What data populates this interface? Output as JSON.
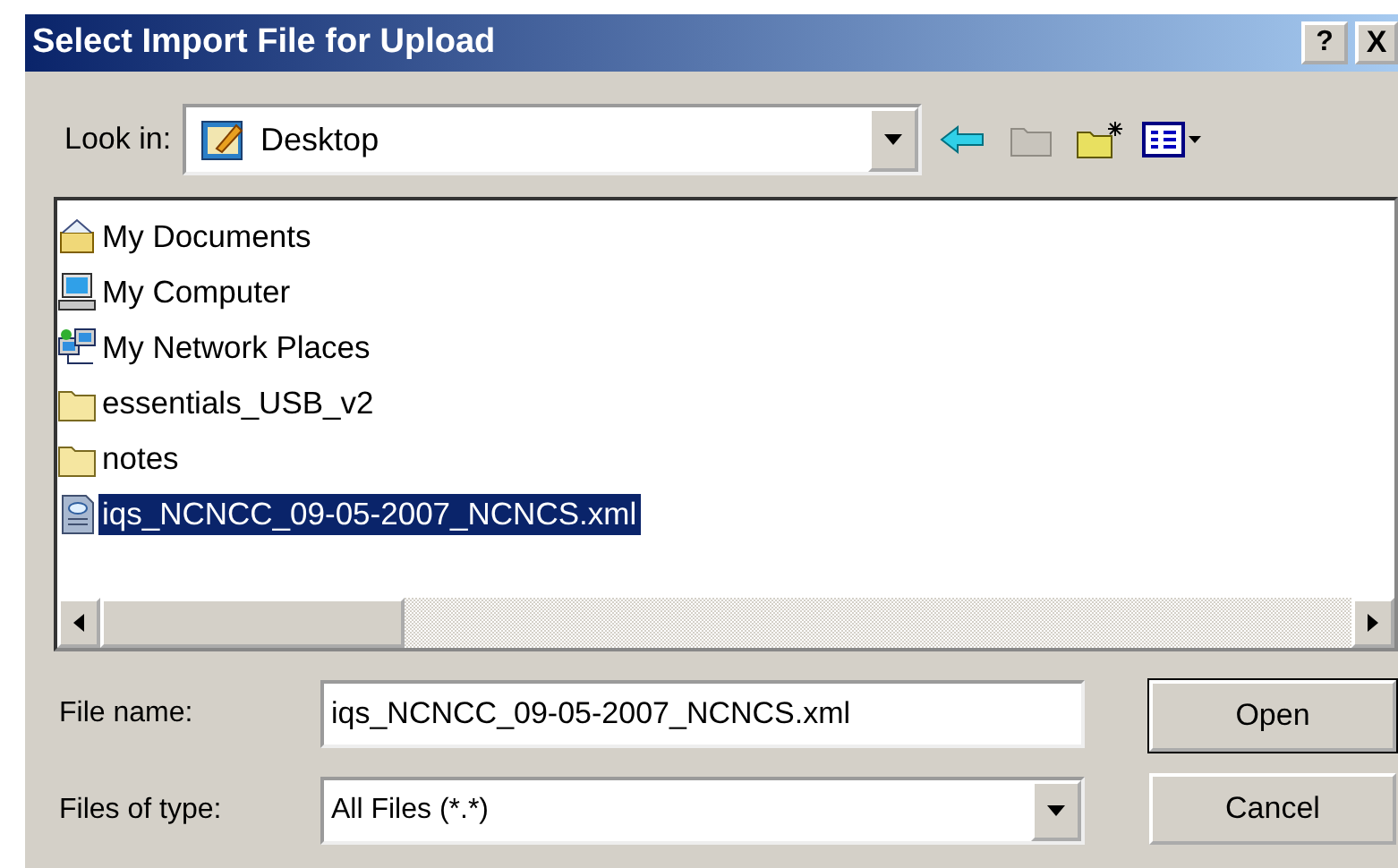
{
  "window": {
    "title": "Select Import File for Upload",
    "buttons": [
      {
        "kind": "help",
        "label": "?"
      },
      {
        "kind": "close",
        "label": "X"
      }
    ]
  },
  "look_in": {
    "label": "Look in:",
    "value": "Desktop"
  },
  "files": [
    {
      "name": "My Documents",
      "kind": "documents",
      "selected": false
    },
    {
      "name": "My Computer",
      "kind": "computer",
      "selected": false
    },
    {
      "name": "My Network Places",
      "kind": "network",
      "selected": false
    },
    {
      "name": "essentials_USB_v2",
      "kind": "folder",
      "selected": false
    },
    {
      "name": "notes",
      "kind": "folder",
      "selected": false
    },
    {
      "name": "iqs_NCNCC_09-05-2007_NCNCS.xml",
      "kind": "xml",
      "selected": true
    }
  ],
  "file_name": {
    "label": "File name:",
    "value": "iqs_NCNCC_09-05-2007_NCNCS.xml"
  },
  "file_type": {
    "label": "Files of type:",
    "value": "All Files (*.*)"
  },
  "actions": [
    {
      "label": "Open",
      "default": true
    },
    {
      "label": "Cancel",
      "default": false
    }
  ]
}
